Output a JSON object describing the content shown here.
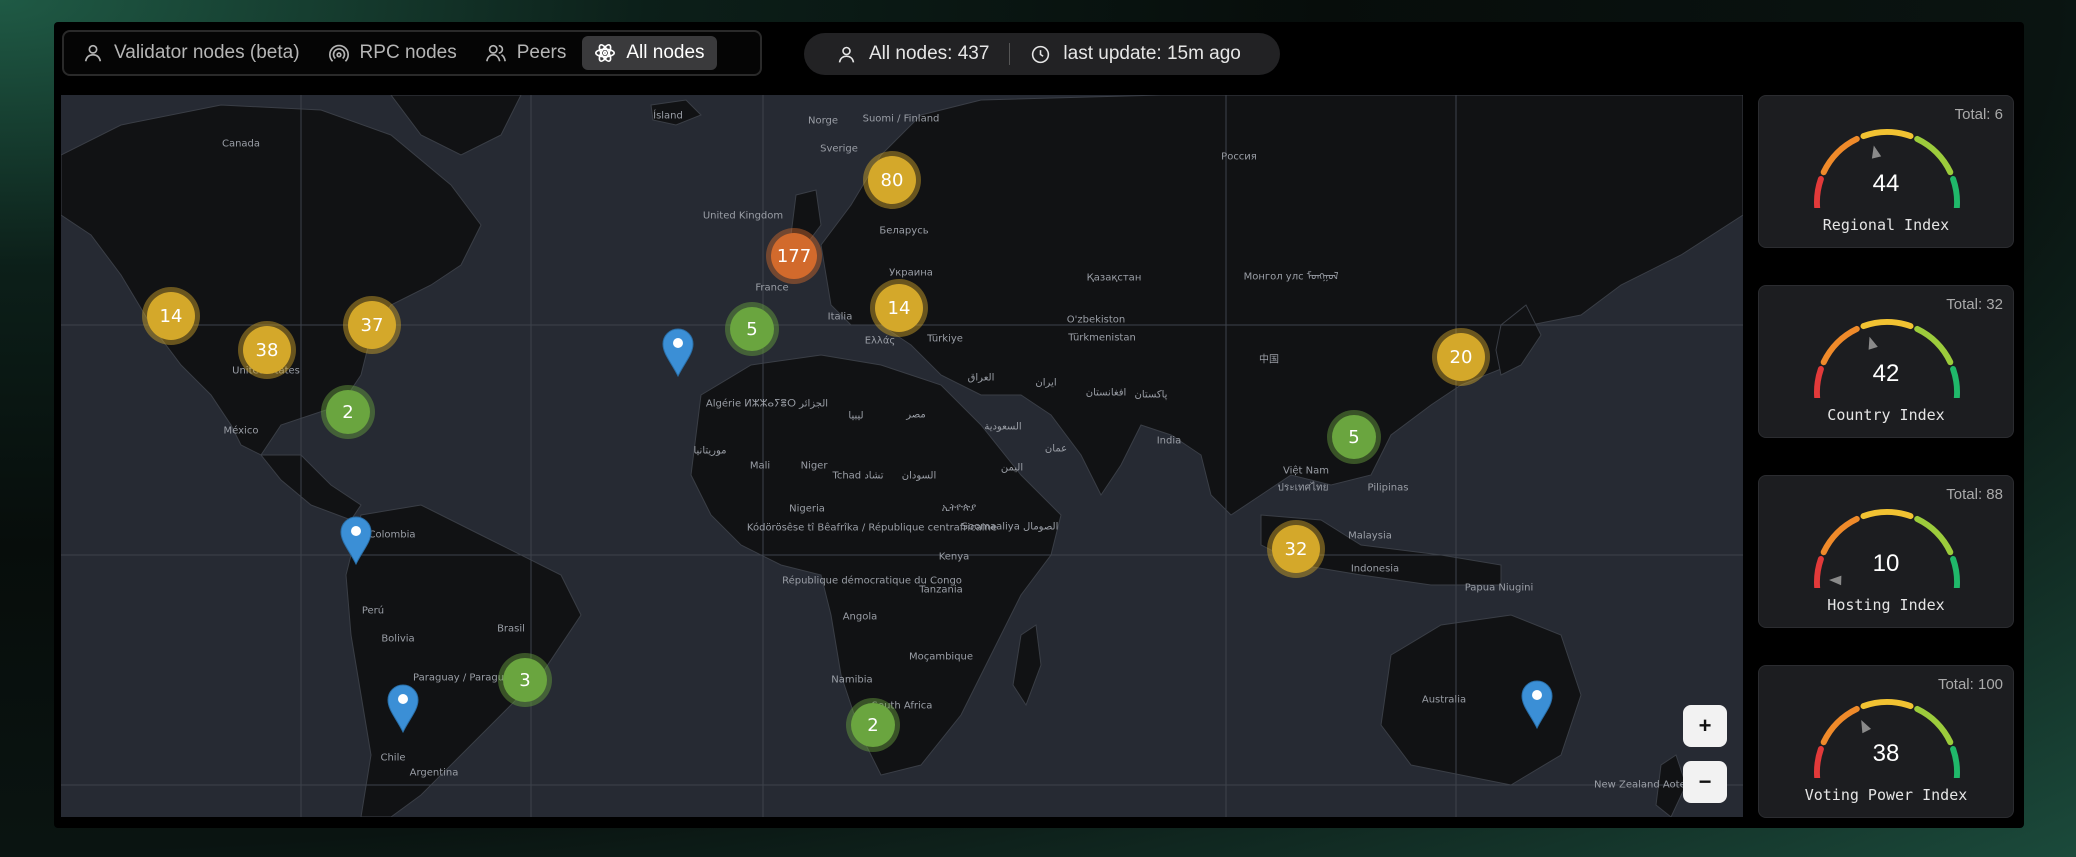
{
  "tabs": [
    {
      "label": "Validator nodes (beta)",
      "icon": "user-icon",
      "active": false
    },
    {
      "label": "RPC nodes",
      "icon": "signal-icon",
      "active": false
    },
    {
      "label": "Peers",
      "icon": "users-icon",
      "active": false
    },
    {
      "label": "All nodes",
      "icon": "atom-icon",
      "active": true
    }
  ],
  "stats": {
    "all_nodes": "All nodes: 437",
    "last_update": "last update: 15m ago"
  },
  "map": {
    "geo_labels": [
      "Canada",
      "Ísland",
      "Suomi / Finland",
      "Norge",
      "Sverige",
      "Россия",
      "United Kingdom",
      "Беларусь",
      "France",
      "Украина",
      "Қазақстан",
      "Монгол улс ᠮᠣᠩᠭᠣᠯ",
      "Italia",
      "O'zbekiston",
      "Türkmenistan",
      "Ελλάς",
      "Türkiye",
      "中国",
      "México",
      "Algérie ⵍⵣⵣⴰⵢⴻⵔ الجزائر",
      "ليبيا",
      "مصر",
      "العراق",
      "ایران",
      "افغانستان",
      "پاکستان",
      "India",
      "السعودية",
      "عمان",
      "اليمن",
      "موريتانيا",
      "Mali",
      "Niger",
      "Tchad تشاد",
      "السودان",
      "Nigeria",
      "ኢትዮጵያ",
      "Kódörösêse tî Bêafrîka / République centrafricaine",
      "Soomaaliya الصومال",
      "Việt Nam",
      "ประเทศไทย",
      "Pilipinas",
      "Colombia",
      "Malaysia",
      "Kenya",
      "République démocratique du Congo",
      "Indonesia",
      "Tanzania",
      "Perú",
      "Brasil",
      "Papua Niugini",
      "Angola",
      "Bolivia",
      "Moçambique",
      "Paraguay / Paraguái",
      "Namibia",
      "Australia",
      "Chile",
      "Argentina",
      "South Africa",
      "New Zealand Aotearoa",
      "United States"
    ],
    "clusters": [
      {
        "count": "14",
        "level": "medium"
      },
      {
        "count": "38",
        "level": "medium"
      },
      {
        "count": "37",
        "level": "medium"
      },
      {
        "count": "2",
        "level": "low"
      },
      {
        "count": "80",
        "level": "medium"
      },
      {
        "count": "177",
        "level": "high"
      },
      {
        "count": "5",
        "level": "low"
      },
      {
        "count": "14",
        "level": "medium"
      },
      {
        "count": "20",
        "level": "medium"
      },
      {
        "count": "5",
        "level": "low"
      },
      {
        "count": "32",
        "level": "medium"
      },
      {
        "count": "3",
        "level": "low"
      },
      {
        "count": "2",
        "level": "low"
      }
    ],
    "single_markers": 4,
    "zoom_in": "+",
    "zoom_out": "−"
  },
  "indices": [
    {
      "total": "Total: 6",
      "value": "44",
      "label": "Regional Index",
      "fraction": 0.44
    },
    {
      "total": "Total: 32",
      "value": "42",
      "label": "Country Index",
      "fraction": 0.42
    },
    {
      "total": "Total: 88",
      "value": "10",
      "label": "Hosting Index",
      "fraction": 0.1
    },
    {
      "total": "Total: 100",
      "value": "38",
      "label": "Voting Power Index",
      "fraction": 0.38
    }
  ],
  "colors": {
    "cluster_medium": "#d4a82a",
    "cluster_low": "#6aa53f",
    "cluster_high": "#d26a2c",
    "marker": "#3b8fd6",
    "map_water": "#262a33",
    "map_land": "#111214"
  }
}
